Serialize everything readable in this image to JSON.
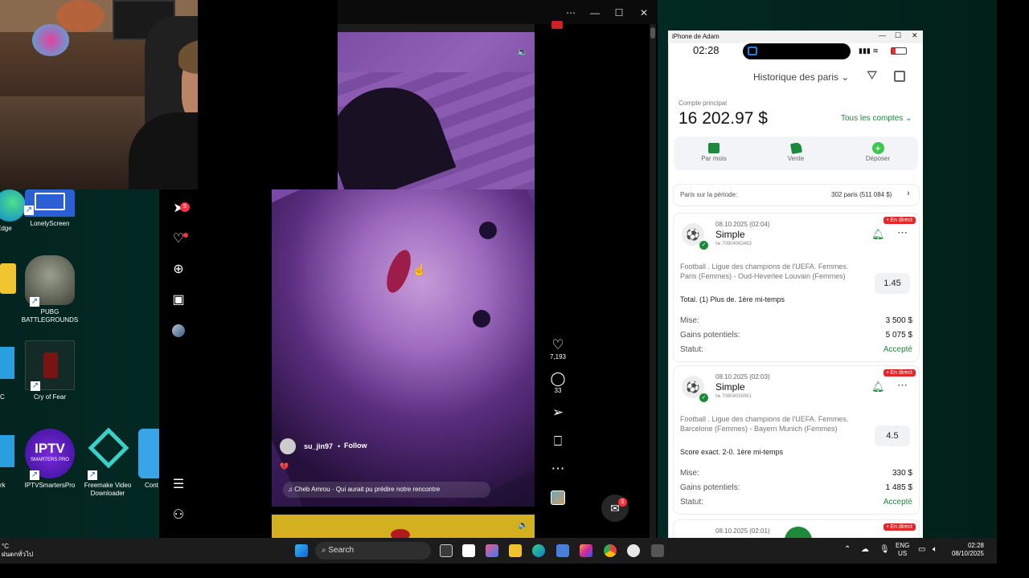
{
  "desktop": {
    "icons": [
      {
        "label": "Edge"
      },
      {
        "label": "LonelyScreen"
      },
      {
        "label": "PUBG BATTLEGROUNDS"
      },
      {
        "label": "Cry of Fear"
      },
      {
        "label": "C"
      },
      {
        "label": "IPTVSmartersPro"
      },
      {
        "label": "Freemake Video Downloader"
      },
      {
        "label": "Cont"
      },
      {
        "label": "rk"
      }
    ],
    "iptv_logo_text": "IPTV",
    "iptv_logo_sub": "SMARTERS PRO"
  },
  "instagram": {
    "notif_count": "5",
    "reel": {
      "username": "su_jin97",
      "follow_label": "Follow",
      "emoji": "💔",
      "audio": "Cheb Amrou · Qui aurait pu prédire notre rencontre",
      "likes": "7,193",
      "comments": "33"
    },
    "messages_count": "5"
  },
  "phone": {
    "window_title": "iPhone de Adam",
    "time": "02:28",
    "header_title": "Historique des paris",
    "account_label": "Compte principal",
    "balance": "16 202.97 $",
    "all_accounts": "Tous les comptes",
    "actions": [
      {
        "label": "Par mois",
        "icon": "calendar-icon"
      },
      {
        "label": "Vente",
        "icon": "tag-icon"
      },
      {
        "label": "Déposer",
        "icon": "plus-circle-icon"
      }
    ],
    "period_label": "Paris sur la période:",
    "period_value": "302 paris (511 084 $)",
    "bets": [
      {
        "date": "08.10.2025 (02:04)",
        "type": "Simple",
        "number": "№ 70904063463",
        "live": "• En direct",
        "description": "Football . Ligue des champions de l'UEFA. Femmes. Paris (Femmes) - Oud-Heverlee Louvain (Femmes)",
        "market": "Total. (1) Plus de. 1ère mi-temps",
        "odds": "1.45",
        "stake_label": "Mise:",
        "stake": "3 500 $",
        "gain_label": "Gains potentiels:",
        "gain": "5 075 $",
        "status_label": "Statut:",
        "status": "Accepté"
      },
      {
        "date": "08.10.2025 (02:03)",
        "type": "Simple",
        "number": "№ 70904035061",
        "live": "• En direct",
        "description": "Football . Ligue des champions de l'UEFA. Femmes. Barcelone (Femmes) - Bayern Munich (Femmes)",
        "market": "Score exact. 2-0. 1ère mi-temps",
        "odds": "4.5",
        "stake_label": "Mise:",
        "stake": "330 $",
        "gain_label": "Gains potentiels:",
        "gain": "1 485 $",
        "status_label": "Statut:",
        "status": "Accepté"
      },
      {
        "date": "08.10.2025 (02:01)",
        "live": "• En direct"
      }
    ]
  },
  "taskbar": {
    "search_placeholder": "Search",
    "lang": "ENG",
    "region": "US",
    "time": "02:28",
    "date": "08/10/2025",
    "weather_temp": "°C",
    "weather_text": "ฝนตกทั่วไป"
  },
  "colors": {
    "accent_green": "#1c8a3a",
    "live_red": "#e3262b",
    "ig_notif": "#ff3040"
  }
}
